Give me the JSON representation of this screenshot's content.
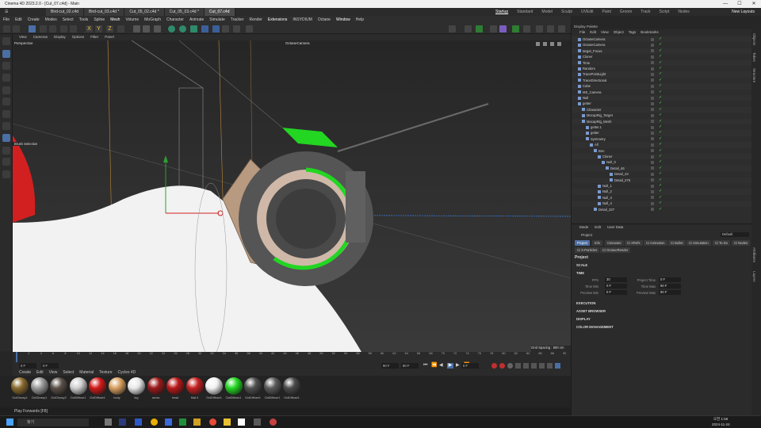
{
  "window": {
    "title": "Cinema 4D 2023.2.0 - [Cut_07.c4d] - Main",
    "controls": [
      "—",
      "☐",
      "✕"
    ]
  },
  "doc_tabs": [
    "Bird-cut_02.c4d",
    "Bird-cut_03.c4d *",
    "Cut_05_02.c4d *",
    "Cut_05_03.c4d *",
    "Cut_07.c4d"
  ],
  "layouts": {
    "items": [
      "Startup",
      "Standard",
      "Model",
      "Sculpt",
      "UVEdit",
      "Paint",
      "Groom",
      "Track",
      "Script",
      "Nodes"
    ],
    "active": "Startup",
    "new_layouts": "New Layouts"
  },
  "main_menu": [
    "File",
    "Edit",
    "Create",
    "Modes",
    "Select",
    "Tools",
    "Spline",
    "Mesh",
    "Volume",
    "MoGraph",
    "Character",
    "Animate",
    "Simulate",
    "Tracker",
    "Render",
    "Extensions",
    "INSYDIUM",
    "Octane",
    "Window",
    "Help"
  ],
  "viewport": {
    "menu": [
      "View",
      "Cameras",
      "Display",
      "Options",
      "Filter",
      "Panel"
    ],
    "label": "Perspective",
    "camera": "OctaneCamera",
    "grid_spacing": "Grid Spacing : 500 cm",
    "brush_label": "Brush Selection"
  },
  "timeline": {
    "ticks": [
      "0",
      "2",
      "4",
      "6",
      "8",
      "10",
      "12",
      "14",
      "16",
      "18",
      "20",
      "22",
      "24",
      "26",
      "28",
      "30",
      "32",
      "34",
      "36",
      "38",
      "40",
      "42",
      "44",
      "46",
      "48",
      "50",
      "52",
      "54",
      "56",
      "58",
      "60",
      "62",
      "64",
      "66",
      "68",
      "70",
      "72",
      "74",
      "76",
      "78",
      "80",
      "82",
      "84",
      "86",
      "88",
      "90"
    ],
    "start": "0 F",
    "current": "0 F",
    "end": "90 F",
    "end2": "90 F",
    "frame_display": "0 F"
  },
  "materials": {
    "menu": [
      "Create",
      "Edit",
      "View",
      "Select",
      "Material",
      "Texture",
      "Cycles 4D"
    ],
    "items": [
      {
        "name": "OctGlossy1",
        "color": "#8a6a2e"
      },
      {
        "name": "OctGlossy1",
        "color": "#9a9a9a"
      },
      {
        "name": "OctGlossy2",
        "color": "#5a5048"
      },
      {
        "name": "OctDiffuse1",
        "color": "#cfcfcf"
      },
      {
        "name": "OctDiffuse1",
        "color": "#d11a1a"
      },
      {
        "name": "body",
        "color": "#d8a060"
      },
      {
        "name": "leg",
        "color": "#e8e8e8"
      },
      {
        "name": "arrow",
        "color": "#9a1a1a"
      },
      {
        "name": "head",
        "color": "#b81818"
      },
      {
        "name": "Mat.3",
        "color": "#c42020"
      },
      {
        "name": "OctDiffuse1",
        "color": "#f2f2f2"
      },
      {
        "name": "OctDiffuse1",
        "color": "#22d622"
      },
      {
        "name": "OctDiffuse1",
        "color": "#505050"
      },
      {
        "name": "OctDiffuse1",
        "color": "#5a5a5a"
      },
      {
        "name": "OctDiffuse1",
        "color": "#4a4a4a"
      }
    ]
  },
  "status": {
    "text": "Play Forwards [F8]"
  },
  "object_manager": {
    "title": "Display Palette",
    "menu": [
      "File",
      "Edit",
      "View",
      "Object",
      "Tags",
      "Bookmarks"
    ],
    "rows": [
      {
        "name": "OctaneCamera",
        "indent": 0
      },
      {
        "name": "OctaneCamera",
        "indent": 0
      },
      {
        "name": "target_Focus",
        "indent": 0
      },
      {
        "name": "Cloner",
        "indent": 0
      },
      {
        "name": "Time",
        "indent": 0
      },
      {
        "name": "Random",
        "indent": 0
      },
      {
        "name": "TracePointLight",
        "indent": 0
      },
      {
        "name": "TraceDirectional",
        "indent": 0
      },
      {
        "name": "Cube",
        "indent": 0
      },
      {
        "name": "MS_Camera",
        "indent": 0
      },
      {
        "name": "Null",
        "indent": 0
      },
      {
        "name": "getter",
        "indent": 0
      },
      {
        "name": "Character",
        "indent": 1
      },
      {
        "name": "MocapRig_Target",
        "indent": 1
      },
      {
        "name": "MocapRig_Mesh",
        "indent": 1
      },
      {
        "name": "getter.1",
        "indent": 2
      },
      {
        "name": "getter",
        "indent": 2
      },
      {
        "name": "Symmetry",
        "indent": 2
      },
      {
        "name": "All",
        "indent": 3
      },
      {
        "name": "Bon",
        "indent": 4
      },
      {
        "name": "Cloner",
        "indent": 5
      },
      {
        "name": "Null_0",
        "indent": 6
      },
      {
        "name": "Detail_46",
        "indent": 7
      },
      {
        "name": "Detail_43",
        "indent": 8
      },
      {
        "name": "Detail_276",
        "indent": 8
      },
      {
        "name": "Null_1",
        "indent": 5
      },
      {
        "name": "Null_2",
        "indent": 5
      },
      {
        "name": "Null_3",
        "indent": 5
      },
      {
        "name": "Null_4",
        "indent": 5
      },
      {
        "name": "Detail_337",
        "indent": 4
      }
    ]
  },
  "attributes": {
    "menu": [
      "Mode",
      "Edit",
      "User Data"
    ],
    "header": "Project",
    "preset": "Default",
    "tabs": [
      "Project",
      "Info",
      "Cineware",
      "Ci XRefs",
      "Ci Animation",
      "Ci Bullet",
      "Ci Simulation",
      "Ci To Do",
      "Ci Nodes",
      "Ci X-Particles",
      "Ci OctaneRender"
    ],
    "title": "Project",
    "sections": [
      "SCALE",
      "TIME",
      "EXECUTION",
      "ASSET BROWSER",
      "DISPLAY",
      "COLOR MANAGEMENT"
    ],
    "fields": {
      "fps_label": "FPS",
      "fps": "30",
      "project_time_label": "Project Time",
      "project_time": "0 F",
      "time_min_label": "Time Min",
      "time_min": "0 F",
      "time_max_label": "Time Max",
      "time_max": "90 F",
      "preview_min_label": "Preview Min",
      "preview_min": "0 F",
      "preview_max_label": "Preview Max",
      "preview_max": "90 F"
    }
  },
  "right_tabs": [
    "Objects",
    "Takes",
    "Structure",
    "Attributes",
    "Layers"
  ],
  "taskbar": {
    "search": "찾기",
    "time": "오전 1:56",
    "date": "2024-11-24"
  }
}
